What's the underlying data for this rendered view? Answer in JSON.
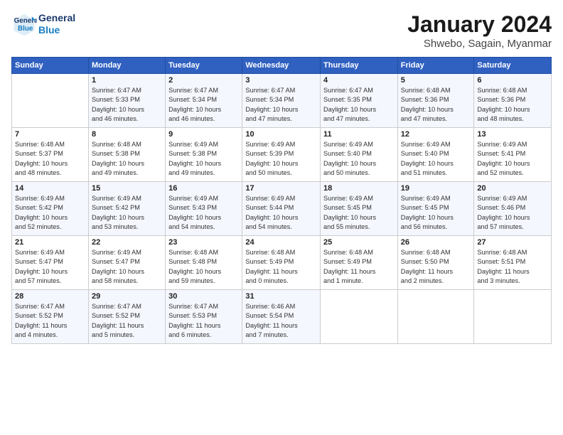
{
  "logo": {
    "line1": "General",
    "line2": "Blue"
  },
  "title": "January 2024",
  "location": "Shwebo, Sagain, Myanmar",
  "days_header": [
    "Sunday",
    "Monday",
    "Tuesday",
    "Wednesday",
    "Thursday",
    "Friday",
    "Saturday"
  ],
  "weeks": [
    [
      {
        "num": "",
        "info": ""
      },
      {
        "num": "1",
        "info": "Sunrise: 6:47 AM\nSunset: 5:33 PM\nDaylight: 10 hours\nand 46 minutes."
      },
      {
        "num": "2",
        "info": "Sunrise: 6:47 AM\nSunset: 5:34 PM\nDaylight: 10 hours\nand 46 minutes."
      },
      {
        "num": "3",
        "info": "Sunrise: 6:47 AM\nSunset: 5:34 PM\nDaylight: 10 hours\nand 47 minutes."
      },
      {
        "num": "4",
        "info": "Sunrise: 6:47 AM\nSunset: 5:35 PM\nDaylight: 10 hours\nand 47 minutes."
      },
      {
        "num": "5",
        "info": "Sunrise: 6:48 AM\nSunset: 5:36 PM\nDaylight: 10 hours\nand 47 minutes."
      },
      {
        "num": "6",
        "info": "Sunrise: 6:48 AM\nSunset: 5:36 PM\nDaylight: 10 hours\nand 48 minutes."
      }
    ],
    [
      {
        "num": "7",
        "info": "Sunrise: 6:48 AM\nSunset: 5:37 PM\nDaylight: 10 hours\nand 48 minutes."
      },
      {
        "num": "8",
        "info": "Sunrise: 6:48 AM\nSunset: 5:38 PM\nDaylight: 10 hours\nand 49 minutes."
      },
      {
        "num": "9",
        "info": "Sunrise: 6:49 AM\nSunset: 5:38 PM\nDaylight: 10 hours\nand 49 minutes."
      },
      {
        "num": "10",
        "info": "Sunrise: 6:49 AM\nSunset: 5:39 PM\nDaylight: 10 hours\nand 50 minutes."
      },
      {
        "num": "11",
        "info": "Sunrise: 6:49 AM\nSunset: 5:40 PM\nDaylight: 10 hours\nand 50 minutes."
      },
      {
        "num": "12",
        "info": "Sunrise: 6:49 AM\nSunset: 5:40 PM\nDaylight: 10 hours\nand 51 minutes."
      },
      {
        "num": "13",
        "info": "Sunrise: 6:49 AM\nSunset: 5:41 PM\nDaylight: 10 hours\nand 52 minutes."
      }
    ],
    [
      {
        "num": "14",
        "info": "Sunrise: 6:49 AM\nSunset: 5:42 PM\nDaylight: 10 hours\nand 52 minutes."
      },
      {
        "num": "15",
        "info": "Sunrise: 6:49 AM\nSunset: 5:42 PM\nDaylight: 10 hours\nand 53 minutes."
      },
      {
        "num": "16",
        "info": "Sunrise: 6:49 AM\nSunset: 5:43 PM\nDaylight: 10 hours\nand 54 minutes."
      },
      {
        "num": "17",
        "info": "Sunrise: 6:49 AM\nSunset: 5:44 PM\nDaylight: 10 hours\nand 54 minutes."
      },
      {
        "num": "18",
        "info": "Sunrise: 6:49 AM\nSunset: 5:45 PM\nDaylight: 10 hours\nand 55 minutes."
      },
      {
        "num": "19",
        "info": "Sunrise: 6:49 AM\nSunset: 5:45 PM\nDaylight: 10 hours\nand 56 minutes."
      },
      {
        "num": "20",
        "info": "Sunrise: 6:49 AM\nSunset: 5:46 PM\nDaylight: 10 hours\nand 57 minutes."
      }
    ],
    [
      {
        "num": "21",
        "info": "Sunrise: 6:49 AM\nSunset: 5:47 PM\nDaylight: 10 hours\nand 57 minutes."
      },
      {
        "num": "22",
        "info": "Sunrise: 6:49 AM\nSunset: 5:47 PM\nDaylight: 10 hours\nand 58 minutes."
      },
      {
        "num": "23",
        "info": "Sunrise: 6:48 AM\nSunset: 5:48 PM\nDaylight: 10 hours\nand 59 minutes."
      },
      {
        "num": "24",
        "info": "Sunrise: 6:48 AM\nSunset: 5:49 PM\nDaylight: 11 hours\nand 0 minutes."
      },
      {
        "num": "25",
        "info": "Sunrise: 6:48 AM\nSunset: 5:49 PM\nDaylight: 11 hours\nand 1 minute."
      },
      {
        "num": "26",
        "info": "Sunrise: 6:48 AM\nSunset: 5:50 PM\nDaylight: 11 hours\nand 2 minutes."
      },
      {
        "num": "27",
        "info": "Sunrise: 6:48 AM\nSunset: 5:51 PM\nDaylight: 11 hours\nand 3 minutes."
      }
    ],
    [
      {
        "num": "28",
        "info": "Sunrise: 6:47 AM\nSunset: 5:52 PM\nDaylight: 11 hours\nand 4 minutes."
      },
      {
        "num": "29",
        "info": "Sunrise: 6:47 AM\nSunset: 5:52 PM\nDaylight: 11 hours\nand 5 minutes."
      },
      {
        "num": "30",
        "info": "Sunrise: 6:47 AM\nSunset: 5:53 PM\nDaylight: 11 hours\nand 6 minutes."
      },
      {
        "num": "31",
        "info": "Sunrise: 6:46 AM\nSunset: 5:54 PM\nDaylight: 11 hours\nand 7 minutes."
      },
      {
        "num": "",
        "info": ""
      },
      {
        "num": "",
        "info": ""
      },
      {
        "num": "",
        "info": ""
      }
    ]
  ]
}
